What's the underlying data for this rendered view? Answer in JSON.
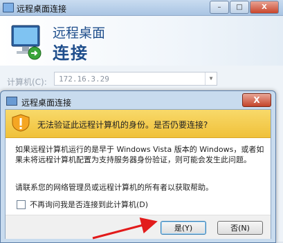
{
  "rdc_window": {
    "title": "远程桌面连接",
    "banner_line1": "远程桌面",
    "banner_line2": "连接",
    "computer_label": "计算机(C):",
    "computer_value": "172.16.3.29"
  },
  "dialog": {
    "title": "远程桌面连接",
    "close_label": "X",
    "warning": "无法验证此远程计算机的身份。是否仍要连接?",
    "body": "如果远程计算机运行的是早于 Windows Vista 版本的 Windows，或者如果未将远程计算机配置为支持服务器身份验证，则可能会发生此问题。",
    "help": "请联系您的网络管理员或远程计算机的所有者以获取帮助。",
    "checkbox_label": "不再询问我是否连接到此计算机(D)",
    "checkbox_checked": false,
    "yes_label": "是(Y)",
    "no_label": "否(N)"
  },
  "window_buttons": {
    "minimize": "–",
    "maximize": "□",
    "close": "X"
  },
  "icons": {
    "monitor": "monitor-icon",
    "warning": "shield-warning-icon",
    "annotation_arrow": "red-arrow-icon"
  },
  "colors": {
    "accent": "#1f4e8c",
    "warning_bar": "#f0c13a",
    "annotation": "#e21b1b"
  }
}
